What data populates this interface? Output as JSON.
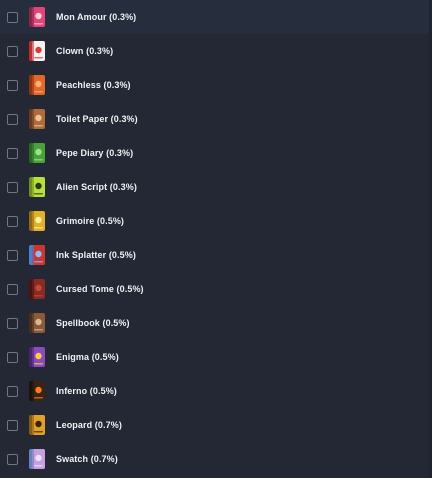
{
  "items": [
    {
      "label": "Mon Amour (0.3%)",
      "icon": "mon-amour-book-icon",
      "cover": "#e0457a",
      "spine": "#8a2449",
      "accent": "#ffd0dc"
    },
    {
      "label": "Clown (0.3%)",
      "icon": "clown-book-icon",
      "cover": "#f2f2f2",
      "spine": "#c42b2b",
      "accent": "#e23a3a"
    },
    {
      "label": "Peachless (0.3%)",
      "icon": "peachless-book-icon",
      "cover": "#e2672a",
      "spine": "#8e3412",
      "accent": "#ffb070"
    },
    {
      "label": "Toilet Paper (0.3%)",
      "icon": "toilet-paper-book-icon",
      "cover": "#b06a3c",
      "spine": "#6b3a1e",
      "accent": "#e8c49a"
    },
    {
      "label": "Pepe Diary (0.3%)",
      "icon": "pepe-diary-book-icon",
      "cover": "#4aa33a",
      "spine": "#2a6a1e",
      "accent": "#9be38a"
    },
    {
      "label": "Alien Script (0.3%)",
      "icon": "alien-script-book-icon",
      "cover": "#b6e03a",
      "spine": "#6f8f1a",
      "accent": "#2c3a10"
    },
    {
      "label": "Grimoire (0.5%)",
      "icon": "grimoire-book-icon",
      "cover": "#e0b02a",
      "spine": "#8f6a12",
      "accent": "#fff0a0"
    },
    {
      "label": "Ink Splatter (0.5%)",
      "icon": "ink-splatter-book-icon",
      "cover": "#c9382f",
      "spine": "#4f7fc9",
      "accent": "#8fb8ff"
    },
    {
      "label": "Cursed Tome (0.5%)",
      "icon": "cursed-tome-book-icon",
      "cover": "#8a2a22",
      "spine": "#4a1410",
      "accent": "#c04a3a"
    },
    {
      "label": "Spellbook (0.5%)",
      "icon": "spellbook-book-icon",
      "cover": "#8a5a3a",
      "spine": "#4a2e1a",
      "accent": "#d8b890"
    },
    {
      "label": "Enigma (0.5%)",
      "icon": "enigma-book-icon",
      "cover": "#8a4ac0",
      "spine": "#4a2470",
      "accent": "#ffcc40"
    },
    {
      "label": "Inferno (0.5%)",
      "icon": "inferno-book-icon",
      "cover": "#3a2418",
      "spine": "#1e120a",
      "accent": "#ff7a20"
    },
    {
      "label": "Leopard (0.7%)",
      "icon": "leopard-book-icon",
      "cover": "#e0a02a",
      "spine": "#8a5a10",
      "accent": "#3a2408"
    },
    {
      "label": "Swatch (0.7%)",
      "icon": "swatch-book-icon",
      "cover": "#c8a0e0",
      "spine": "#6a80c0",
      "accent": "#f0e0ff"
    }
  ]
}
